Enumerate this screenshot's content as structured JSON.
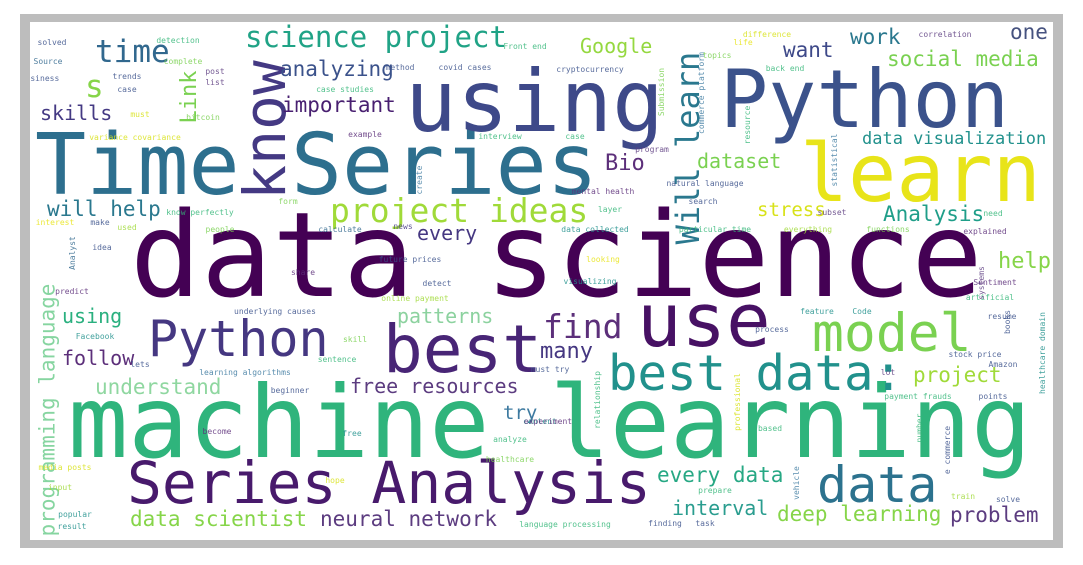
{
  "words": [
    {
      "text": "data science",
      "color": "#440154"
    },
    {
      "text": "machine learning",
      "color": "#2fb47c"
    },
    {
      "text": "Time Series",
      "color": "#2d6f8e"
    },
    {
      "text": "using",
      "color": "#3e4989"
    },
    {
      "text": "Python",
      "color": "#3b528b"
    },
    {
      "text": "learn",
      "color": "#e8e419"
    },
    {
      "text": "know",
      "color": "#443983"
    },
    {
      "text": "Will learn",
      "color": "#2a788e"
    },
    {
      "text": "use",
      "color": "#471164"
    },
    {
      "text": "best",
      "color": "#482576"
    },
    {
      "text": "Python",
      "color": "#453781"
    },
    {
      "text": "model",
      "color": "#7ad151"
    },
    {
      "text": "best data:",
      "color": "#21918c"
    },
    {
      "text": "data",
      "color": "#2c728e"
    },
    {
      "text": "Series Analysis",
      "color": "#481a6c"
    },
    {
      "text": "science project",
      "color": "#20a386"
    },
    {
      "text": "time",
      "color": "#31688e"
    },
    {
      "text": "s",
      "color": "#86d549"
    },
    {
      "text": "skills",
      "color": "#443983"
    },
    {
      "text": "Link",
      "color": "#7ad151"
    },
    {
      "text": "analyzing",
      "color": "#3b528b"
    },
    {
      "text": "important",
      "color": "#481f70"
    },
    {
      "text": "will help",
      "color": "#2a788e"
    },
    {
      "text": "project ideas",
      "color": "#a0da39"
    },
    {
      "text": "every",
      "color": "#453781"
    },
    {
      "text": "Google",
      "color": "#95d840"
    },
    {
      "text": "want",
      "color": "#3e4989"
    },
    {
      "text": "work",
      "color": "#2a788e"
    },
    {
      "text": "one",
      "color": "#46527f"
    },
    {
      "text": "social media",
      "color": "#7ad151"
    },
    {
      "text": "data visualization",
      "color": "#21918c"
    },
    {
      "text": "Bio",
      "color": "#5c2f7a"
    },
    {
      "text": "dataset",
      "color": "#7ad151"
    },
    {
      "text": "stress",
      "color": "#d8e219"
    },
    {
      "text": "Analysis",
      "color": "#1f9e89"
    },
    {
      "text": "help",
      "color": "#86d549"
    },
    {
      "text": "using",
      "color": "#2ab07f"
    },
    {
      "text": "follow",
      "color": "#5c2f7a"
    },
    {
      "text": "understand",
      "color": "#8fd7a0"
    },
    {
      "text": "free resources",
      "color": "#5c3c80"
    },
    {
      "text": "patterns",
      "color": "#8cd29f"
    },
    {
      "text": "try",
      "color": "#3d7aa0"
    },
    {
      "text": "data scientist",
      "color": "#86d549"
    },
    {
      "text": "neural network",
      "color": "#5c3c80"
    },
    {
      "text": "programming language",
      "color": "#86d5a0"
    },
    {
      "text": "find",
      "color": "#5c2f7a"
    },
    {
      "text": "many",
      "color": "#453781"
    },
    {
      "text": "project",
      "color": "#a0da39"
    },
    {
      "text": "every data",
      "color": "#27a884"
    },
    {
      "text": "interval",
      "color": "#2a9d8f"
    },
    {
      "text": "deep learning",
      "color": "#86d549"
    },
    {
      "text": "problem",
      "color": "#5c3c80"
    },
    {
      "text": "solved",
      "color": "#3b528b"
    },
    {
      "text": "Source",
      "color": "#31688e"
    },
    {
      "text": "business",
      "color": "#3b528b"
    },
    {
      "text": "trends",
      "color": "#3b528b"
    },
    {
      "text": "case",
      "color": "#3b528b"
    },
    {
      "text": "must",
      "color": "#d8e219"
    },
    {
      "text": "detection",
      "color": "#35b779"
    },
    {
      "text": "complete",
      "color": "#7ad151"
    },
    {
      "text": "post",
      "color": "#5c3c80"
    },
    {
      "text": "list",
      "color": "#5c3c80"
    },
    {
      "text": "bitcoin",
      "color": "#7ad151"
    },
    {
      "text": "method",
      "color": "#3b528b"
    },
    {
      "text": "covid cases",
      "color": "#3b528b"
    },
    {
      "text": "case studies",
      "color": "#35b779"
    },
    {
      "text": "variance covariance",
      "color": "#d8e219"
    },
    {
      "text": "example",
      "color": "#5c2f7a"
    },
    {
      "text": "interview",
      "color": "#35b779"
    },
    {
      "text": "Front end",
      "color": "#35b779"
    },
    {
      "text": "form",
      "color": "#7ad151"
    },
    {
      "text": "know perfectly",
      "color": "#35b779"
    },
    {
      "text": "interest",
      "color": "#e8e419"
    },
    {
      "text": "make",
      "color": "#3b528b"
    },
    {
      "text": "used",
      "color": "#a0da39"
    },
    {
      "text": "people",
      "color": "#7ad151"
    },
    {
      "text": "calculate",
      "color": "#31688e"
    },
    {
      "text": "news",
      "color": "#443983"
    },
    {
      "text": "idea",
      "color": "#3b528b"
    },
    {
      "text": "future prices",
      "color": "#3b528b"
    },
    {
      "text": "share",
      "color": "#5c2f7a"
    },
    {
      "text": "Analyst",
      "color": "#31688e"
    },
    {
      "text": "create",
      "color": "#3d7aa0"
    },
    {
      "text": "life",
      "color": "#e8e419"
    },
    {
      "text": "difference",
      "color": "#d8e219"
    },
    {
      "text": "correlation",
      "color": "#5c3c80"
    },
    {
      "text": "topics",
      "color": "#7ad151"
    },
    {
      "text": "cryptocurrency",
      "color": "#3b528b"
    },
    {
      "text": "back end",
      "color": "#35b779"
    },
    {
      "text": "case",
      "color": "#35b779"
    },
    {
      "text": "program",
      "color": "#5c3c80"
    },
    {
      "text": "mental health",
      "color": "#5c2f7a"
    },
    {
      "text": "natural language",
      "color": "#3b528b"
    },
    {
      "text": "search",
      "color": "#3b528b"
    },
    {
      "text": "layer",
      "color": "#35b779"
    },
    {
      "text": "subset",
      "color": "#5c3c80"
    },
    {
      "text": "need",
      "color": "#35b779"
    },
    {
      "text": "data collected",
      "color": "#21918c"
    },
    {
      "text": "particular time",
      "color": "#35b779"
    },
    {
      "text": "everything",
      "color": "#a0da39"
    },
    {
      "text": "functions",
      "color": "#7ad151"
    },
    {
      "text": "explained",
      "color": "#5c2f7a"
    },
    {
      "text": "looking",
      "color": "#e8e419"
    },
    {
      "text": "Submission",
      "color": "#7ad151"
    },
    {
      "text": "commerce platform",
      "color": "#3d7aa0"
    },
    {
      "text": "resource",
      "color": "#35b779"
    },
    {
      "text": "statistical",
      "color": "#3d7aa0"
    },
    {
      "text": "predict",
      "color": "#5c2f7a"
    },
    {
      "text": "detect",
      "color": "#3b528b"
    },
    {
      "text": "online payment",
      "color": "#a0da39"
    },
    {
      "text": "underlying causes",
      "color": "#3b528b"
    },
    {
      "text": "Facebook",
      "color": "#21918c"
    },
    {
      "text": "skill",
      "color": "#7ad151"
    },
    {
      "text": "lets",
      "color": "#3b528b"
    },
    {
      "text": "sentence",
      "color": "#35b779"
    },
    {
      "text": "learning algorithms",
      "color": "#3d7aa0"
    },
    {
      "text": "beginner",
      "color": "#3b528b"
    },
    {
      "text": "become",
      "color": "#5c2f7a"
    },
    {
      "text": "free",
      "color": "#21918c"
    },
    {
      "text": "media posts",
      "color": "#d8e219"
    },
    {
      "text": "hope",
      "color": "#d8e219"
    },
    {
      "text": "input",
      "color": "#a0da39"
    },
    {
      "text": "popular",
      "color": "#21918c"
    },
    {
      "text": "result",
      "color": "#21918c"
    },
    {
      "text": "analyze",
      "color": "#35b779"
    },
    {
      "text": "healthcare",
      "color": "#7ad151"
    },
    {
      "text": "content",
      "color": "#21918c"
    },
    {
      "text": "visualizing",
      "color": "#21918c"
    },
    {
      "text": "Sentiment",
      "color": "#5c2f7a"
    },
    {
      "text": "artificial",
      "color": "#35b779"
    },
    {
      "text": "feature",
      "color": "#21918c"
    },
    {
      "text": "Code",
      "color": "#21918c"
    },
    {
      "text": "process",
      "color": "#3b528b"
    },
    {
      "text": "resume",
      "color": "#3b528b"
    },
    {
      "text": "stock price",
      "color": "#3b528b"
    },
    {
      "text": "Amazon",
      "color": "#3b528b"
    },
    {
      "text": "lot",
      "color": "#5c3c80"
    },
    {
      "text": "payment frauds",
      "color": "#35b779"
    },
    {
      "text": "points",
      "color": "#3b528b"
    },
    {
      "text": "must try",
      "color": "#3b528b"
    },
    {
      "text": "experiment",
      "color": "#5c2f7a"
    },
    {
      "text": "based",
      "color": "#35b779"
    },
    {
      "text": "prepare",
      "color": "#35b779"
    },
    {
      "text": "train",
      "color": "#a0da39"
    },
    {
      "text": "solve",
      "color": "#3b528b"
    },
    {
      "text": "language processing",
      "color": "#35b779"
    },
    {
      "text": "finding",
      "color": "#3b528b"
    },
    {
      "text": "task",
      "color": "#3b528b"
    },
    {
      "text": "professional",
      "color": "#d8e219"
    },
    {
      "text": "relationship",
      "color": "#35b779"
    },
    {
      "text": "vehicle",
      "color": "#3d7aa0"
    },
    {
      "text": "number",
      "color": "#35b779"
    },
    {
      "text": "e commerce",
      "color": "#3b528b"
    },
    {
      "text": "healthcare domain",
      "color": "#21918c"
    },
    {
      "text": "books",
      "color": "#3b528b"
    },
    {
      "text": "systems",
      "color": "#5c3c80"
    }
  ]
}
